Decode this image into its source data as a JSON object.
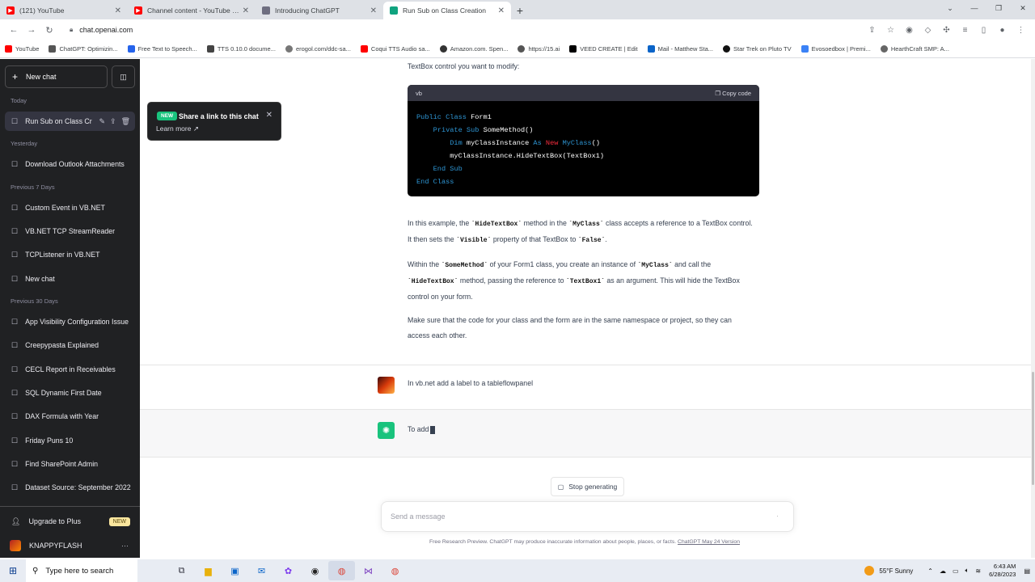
{
  "browser": {
    "tabs": [
      {
        "title": "(121) YouTube",
        "color": "#ff0000",
        "active": false
      },
      {
        "title": "Channel content - YouTube Stu",
        "color": "#ff0000",
        "active": false
      },
      {
        "title": "Introducing ChatGPT",
        "color": "#6e6e80",
        "active": false
      },
      {
        "title": "Run Sub on Class Creation",
        "color": "#10a37f",
        "active": true
      }
    ],
    "url": "chat.openai.com",
    "bookmarks": [
      "YouTube",
      "ChatGPT: Optimizin...",
      "Free Text to Speech...",
      "TTS 0.10.0 docume...",
      "erogol.com/ddc-sa...",
      "Coqui TTS Audio sa...",
      "Amazon.com. Spen...",
      "https://15.ai",
      "VEED CREATE | Edit",
      "Mail - Matthew Sta...",
      "Star Trek on Pluto TV",
      "Evosoedbox | Premi...",
      "HearthCraft SMP: A..."
    ]
  },
  "sidebar": {
    "new_chat": "New chat",
    "sections": {
      "today": "Today",
      "yesterday": "Yesterday",
      "prev7": "Previous 7 Days",
      "prev30": "Previous 30 Days"
    },
    "chats": {
      "c0": "Run Sub on Class Cr",
      "c1": "Download Outlook Attachments",
      "c2": "Custom Event in VB.NET",
      "c3": "VB.NET TCP StreamReader",
      "c4": "TCPListener in VB.NET",
      "c5": "New chat",
      "c6": "App Visibility Configuration Issue",
      "c7": "Creepypasta Explained",
      "c8": "CECL Report in Receivables",
      "c9": "SQL Dynamic First Date",
      "c10": "DAX Formula with Year",
      "c11": "Friday Puns 10",
      "c12": "Find SharePoint Admin",
      "c13": "Dataset Source: September 2022"
    },
    "upgrade": "Upgrade to Plus",
    "new_badge": "NEW",
    "username": "KNAPPYFLASH",
    "more": "···"
  },
  "toast": {
    "tag": "NEW",
    "title": "Share a link to this chat",
    "learn_more": "Learn more"
  },
  "conversation": {
    "intro_tail": "TextBox control you want to modify:",
    "code": {
      "lang": "vb",
      "copy": "Copy code"
    },
    "p1_a": "In this example, the ",
    "p1_code1": "`HideTextBox`",
    "p1_b": " method in the ",
    "p1_code2": "`MyClass`",
    "p1_c": " class accepts a reference to a TextBox control. It then sets the ",
    "p1_code3": "`Visible`",
    "p1_d": " property of that TextBox to ",
    "p1_code4": "`False`",
    "p1_e": ".",
    "p2_a": "Within the ",
    "p2_code1": "`SomeMethod`",
    "p2_b": " of your Form1 class, you create an instance of ",
    "p2_code2": "`MyClass`",
    "p2_c": " and call the ",
    "p2_code3": "`HideTextBox`",
    "p2_d": " method, passing the reference to ",
    "p2_code4": "`TextBox1`",
    "p2_e": " as an argument. This will hide the TextBox control on your form.",
    "p3": "Make sure that the code for your class and the form are in the same namespace or project, so they can access each other.",
    "user_message": "In vb.net add a label to a tableflowpanel",
    "assistant_partial": "To add"
  },
  "composer": {
    "stop": "Stop generating",
    "placeholder": "Send a message",
    "footer": "Free Research Preview. ChatGPT may produce inaccurate information about people, places, or facts.",
    "footer_link": "ChatGPT May 24 Version"
  },
  "taskbar": {
    "search": "Type here to search",
    "weather": "55°F  Sunny",
    "time": "6:43 AM",
    "date": "6/28/2023"
  }
}
